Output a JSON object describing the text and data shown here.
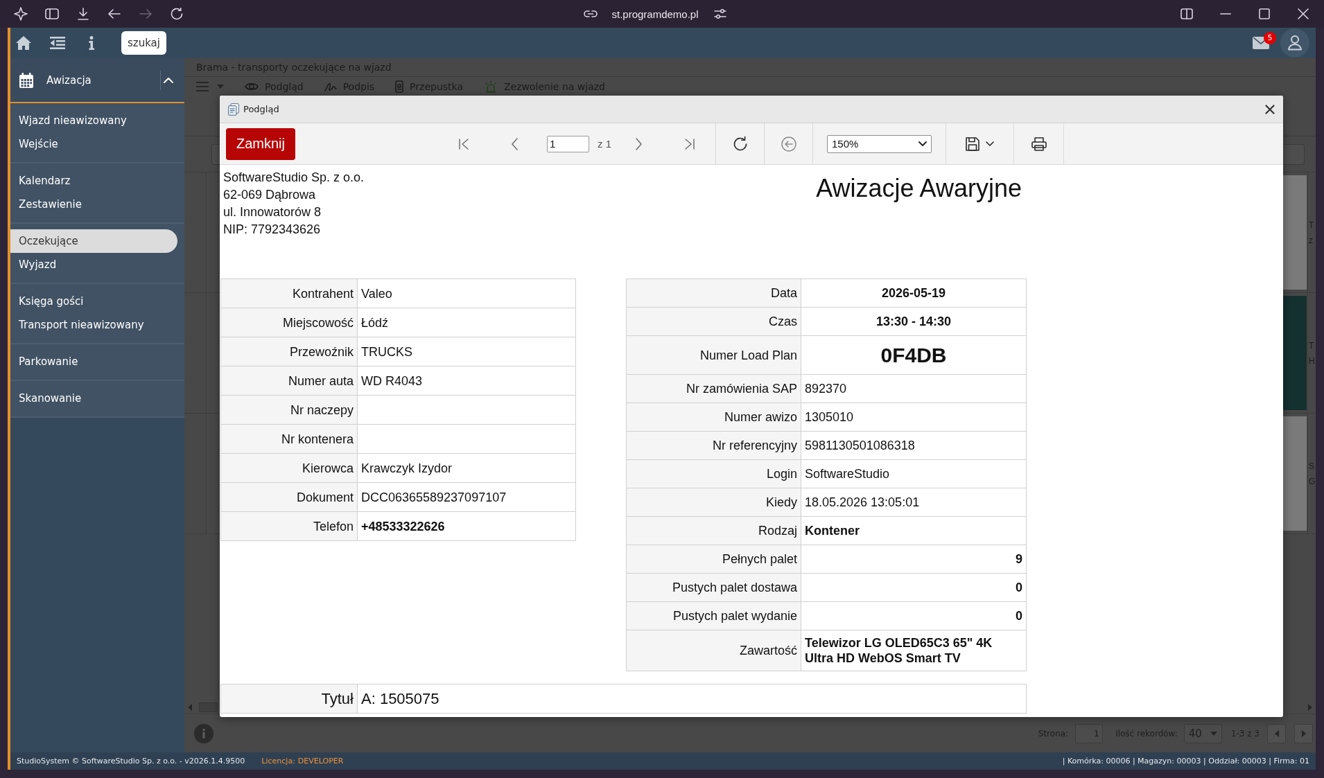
{
  "browser": {
    "forward": {
      "disabled": true
    },
    "url": "st.programdemo.pl"
  },
  "app_header": {
    "search": "szukaj",
    "mail_badge": "5"
  },
  "sidebar": {
    "header": {
      "label": "Awizacja",
      "expanded": true
    },
    "groups": [
      {
        "items": [
          {
            "label": "Wjazd nieawizowany",
            "selected": false
          },
          {
            "label": "Wejście",
            "selected": false
          }
        ]
      },
      {
        "items": [
          {
            "label": "Kalendarz",
            "selected": false
          },
          {
            "label": "Zestawienie",
            "selected": false
          }
        ]
      },
      {
        "items": [
          {
            "label": "Oczekujące",
            "selected": true
          },
          {
            "label": "Wyjazd",
            "selected": false
          }
        ]
      },
      {
        "items": [
          {
            "label": "Księga gości",
            "selected": false
          },
          {
            "label": "Transport nieawizowany",
            "selected": false
          }
        ]
      },
      {
        "items": [
          {
            "label": "Parkowanie",
            "selected": false
          }
        ]
      },
      {
        "items": [
          {
            "label": "Skanowanie",
            "selected": false
          }
        ]
      }
    ]
  },
  "page": {
    "title": "Brama - transporty oczekujące na wjazd",
    "toolbar": [
      {
        "label": "Podgląd"
      },
      {
        "label": "Podpis"
      },
      {
        "label": "Przepustka"
      },
      {
        "label": "Zezwolenie na wjazd"
      }
    ],
    "grid": {
      "rows": [
        {
          "lines": [
            "T",
            "z"
          ]
        },
        {
          "lines": [
            "T",
            "H"
          ]
        },
        {
          "lines": [
            "S",
            "G"
          ]
        }
      ]
    },
    "pager": {
      "page_label": "Strona:",
      "page": "1",
      "records_label": "Ilość rekordów:",
      "records": "40",
      "range": "1-3 z 3"
    }
  },
  "dialog": {
    "title": "Podgląd",
    "toolbar": {
      "close_label": "Zamknij",
      "page": "1",
      "page_count": "z 1",
      "zoom": "150%"
    },
    "report": {
      "company_lines": [
        "SoftwareStudio Sp. z o.o.",
        "62-069 Dąbrowa",
        "ul. Innowatorów 8",
        "NIP: 7792343626"
      ],
      "title": "Awizacje Awaryjne",
      "left_table": [
        {
          "label": "Kontrahent",
          "value": "Valeo",
          "kind": "plain"
        },
        {
          "label": "Miejscowość",
          "value": "Łódź",
          "kind": "plain"
        },
        {
          "label": "Przewoźnik",
          "value": "TRUCKS",
          "kind": "plain"
        },
        {
          "label": "Numer auta",
          "value": "WD R4043",
          "kind": "plain"
        },
        {
          "label": "Nr naczepy",
          "kind": "plain"
        },
        {
          "label": "Nr kontenera",
          "kind": "plain"
        },
        {
          "label": "Kierowca",
          "value": "Krawczyk Izydor",
          "kind": "plain"
        },
        {
          "label": "Dokument",
          "value": "DCC06365589237097107",
          "kind": "plain"
        },
        {
          "label": "Telefon",
          "value": "+48533322626",
          "kind": "emphasis"
        }
      ],
      "right_table": [
        {
          "label": "Data",
          "value": "2026-05-19",
          "kind": "centered"
        },
        {
          "label": "Czas",
          "value": "13:30 - 14:30",
          "kind": "centered"
        },
        {
          "label": "Numer Load Plan",
          "value": "0F4DB",
          "kind": "headline"
        },
        {
          "label": "Nr zamówienia SAP",
          "value": "892370",
          "kind": "plain"
        },
        {
          "label": "Numer awizo",
          "value": "1305010",
          "kind": "plain"
        },
        {
          "label": "Nr referencyjny",
          "value": "5981130501086318",
          "kind": "plain"
        },
        {
          "label": "Login",
          "value": "SoftwareStudio",
          "kind": "plain"
        },
        {
          "label": "Kiedy",
          "value": "18.05.2026 13:05:01",
          "kind": "plain"
        },
        {
          "label": "Rodzaj",
          "value": "Kontener",
          "kind": "emphasis"
        },
        {
          "label": "Pełnych palet",
          "value": "9",
          "kind": "count"
        },
        {
          "label": "Pustych palet dostawa",
          "value": "0",
          "kind": "count"
        },
        {
          "label": "Pustych palet wydanie",
          "value": "0",
          "kind": "count"
        },
        {
          "label": "Zawartość",
          "value": "Telewizor LG OLED65C3 65\" 4K Ultra HD WebOS Smart TV",
          "kind": "emphasis"
        }
      ],
      "footer_rows": [
        {
          "label": "Tytuł",
          "value": "A: 1505075"
        }
      ]
    }
  },
  "status_bar": {
    "copyright": "StudioSystem © SoftwareStudio Sp. z o.o. - v2026.1.4.9500",
    "license_label": "Licencja:",
    "license_value": "DEVELOPER",
    "context": "| Komórka: 00006 | Magazyn: 00003 | Oddział: 00003 | Firma: 01"
  }
}
